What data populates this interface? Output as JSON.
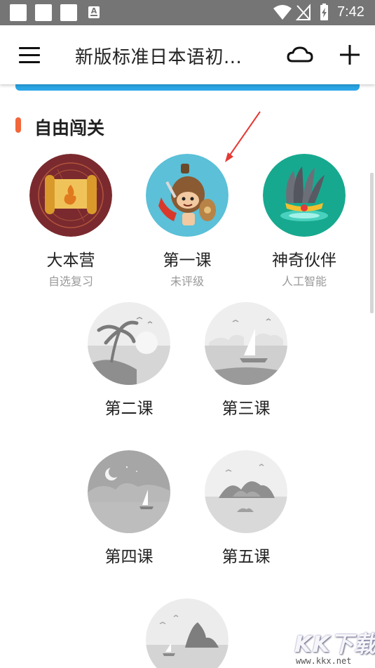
{
  "status_bar": {
    "time": "7:42",
    "notification_icon_label": "A"
  },
  "app_bar": {
    "title": "新版标准日本语初..."
  },
  "section": {
    "title": "自由闯关"
  },
  "nodes": [
    {
      "title": "大本营",
      "subtitle": "自选复习",
      "state": "unlocked"
    },
    {
      "title": "第一课",
      "subtitle": "未评级",
      "state": "unlocked"
    },
    {
      "title": "神奇伙伴",
      "subtitle": "人工智能",
      "state": "unlocked"
    },
    {
      "title": "第二课",
      "state": "locked"
    },
    {
      "title": "第三课",
      "state": "locked"
    },
    {
      "title": "第四课",
      "state": "locked"
    },
    {
      "title": "第五课",
      "state": "locked"
    },
    {
      "title": "",
      "state": "locked"
    }
  ],
  "watermark": {
    "text": "KK下载",
    "url": "www.kkx.net"
  },
  "colors": {
    "status_bar": "#757575",
    "accent_orange": "#f2663b",
    "accent_blue": "#2aa6e6",
    "camp_bg": "#7a2a2e",
    "lesson1_bg": "#5bc0d8",
    "partner_bg": "#17a98f",
    "locked_grey": "#cfcfcf"
  }
}
